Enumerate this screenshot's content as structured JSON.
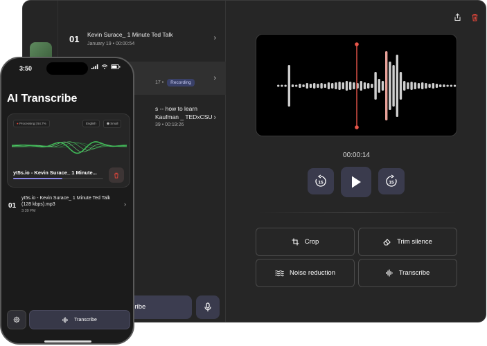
{
  "mac": {
    "recordings": [
      {
        "num": "01",
        "title": "Kevin Surace_ 1 Minute Ted Talk",
        "sub": "January 19 • 00:00:54"
      },
      {
        "num": "",
        "title": "",
        "sub": "17 •",
        "badge": "Recording"
      },
      {
        "num": "",
        "title_line1": "s -- how to learn",
        "title_line2": "Kaufman _ TEDxCSU",
        "sub": "39 • 00:19:26"
      }
    ],
    "transcribe_label": "scribe",
    "player": {
      "time": "00:00:14",
      "skip_back": "15",
      "skip_forward": "15"
    },
    "tools": {
      "crop": "Crop",
      "trim": "Trim silence",
      "noise": "Noise reduction",
      "transcribe": "Transcribe"
    },
    "colors": {
      "accent": "#3a3b4d",
      "playhead": "#e8564a",
      "delete": "#e0453a"
    }
  },
  "phone": {
    "time": "3:50",
    "title": "AI Transcribe",
    "card": {
      "status": "Processing | 54.7%",
      "language": "English",
      "model": "Small",
      "file_title": "yt5s.io - Kevin Surace_ 1 Minute...",
      "progress": 0.547
    },
    "row": {
      "num": "01",
      "title": "yt5s.io - Kevin Surace_ 1 Minute Ted Talk (128 kbps).mp3",
      "sub": "3:39 PM"
    },
    "transcribe_label": "Transcribe"
  }
}
